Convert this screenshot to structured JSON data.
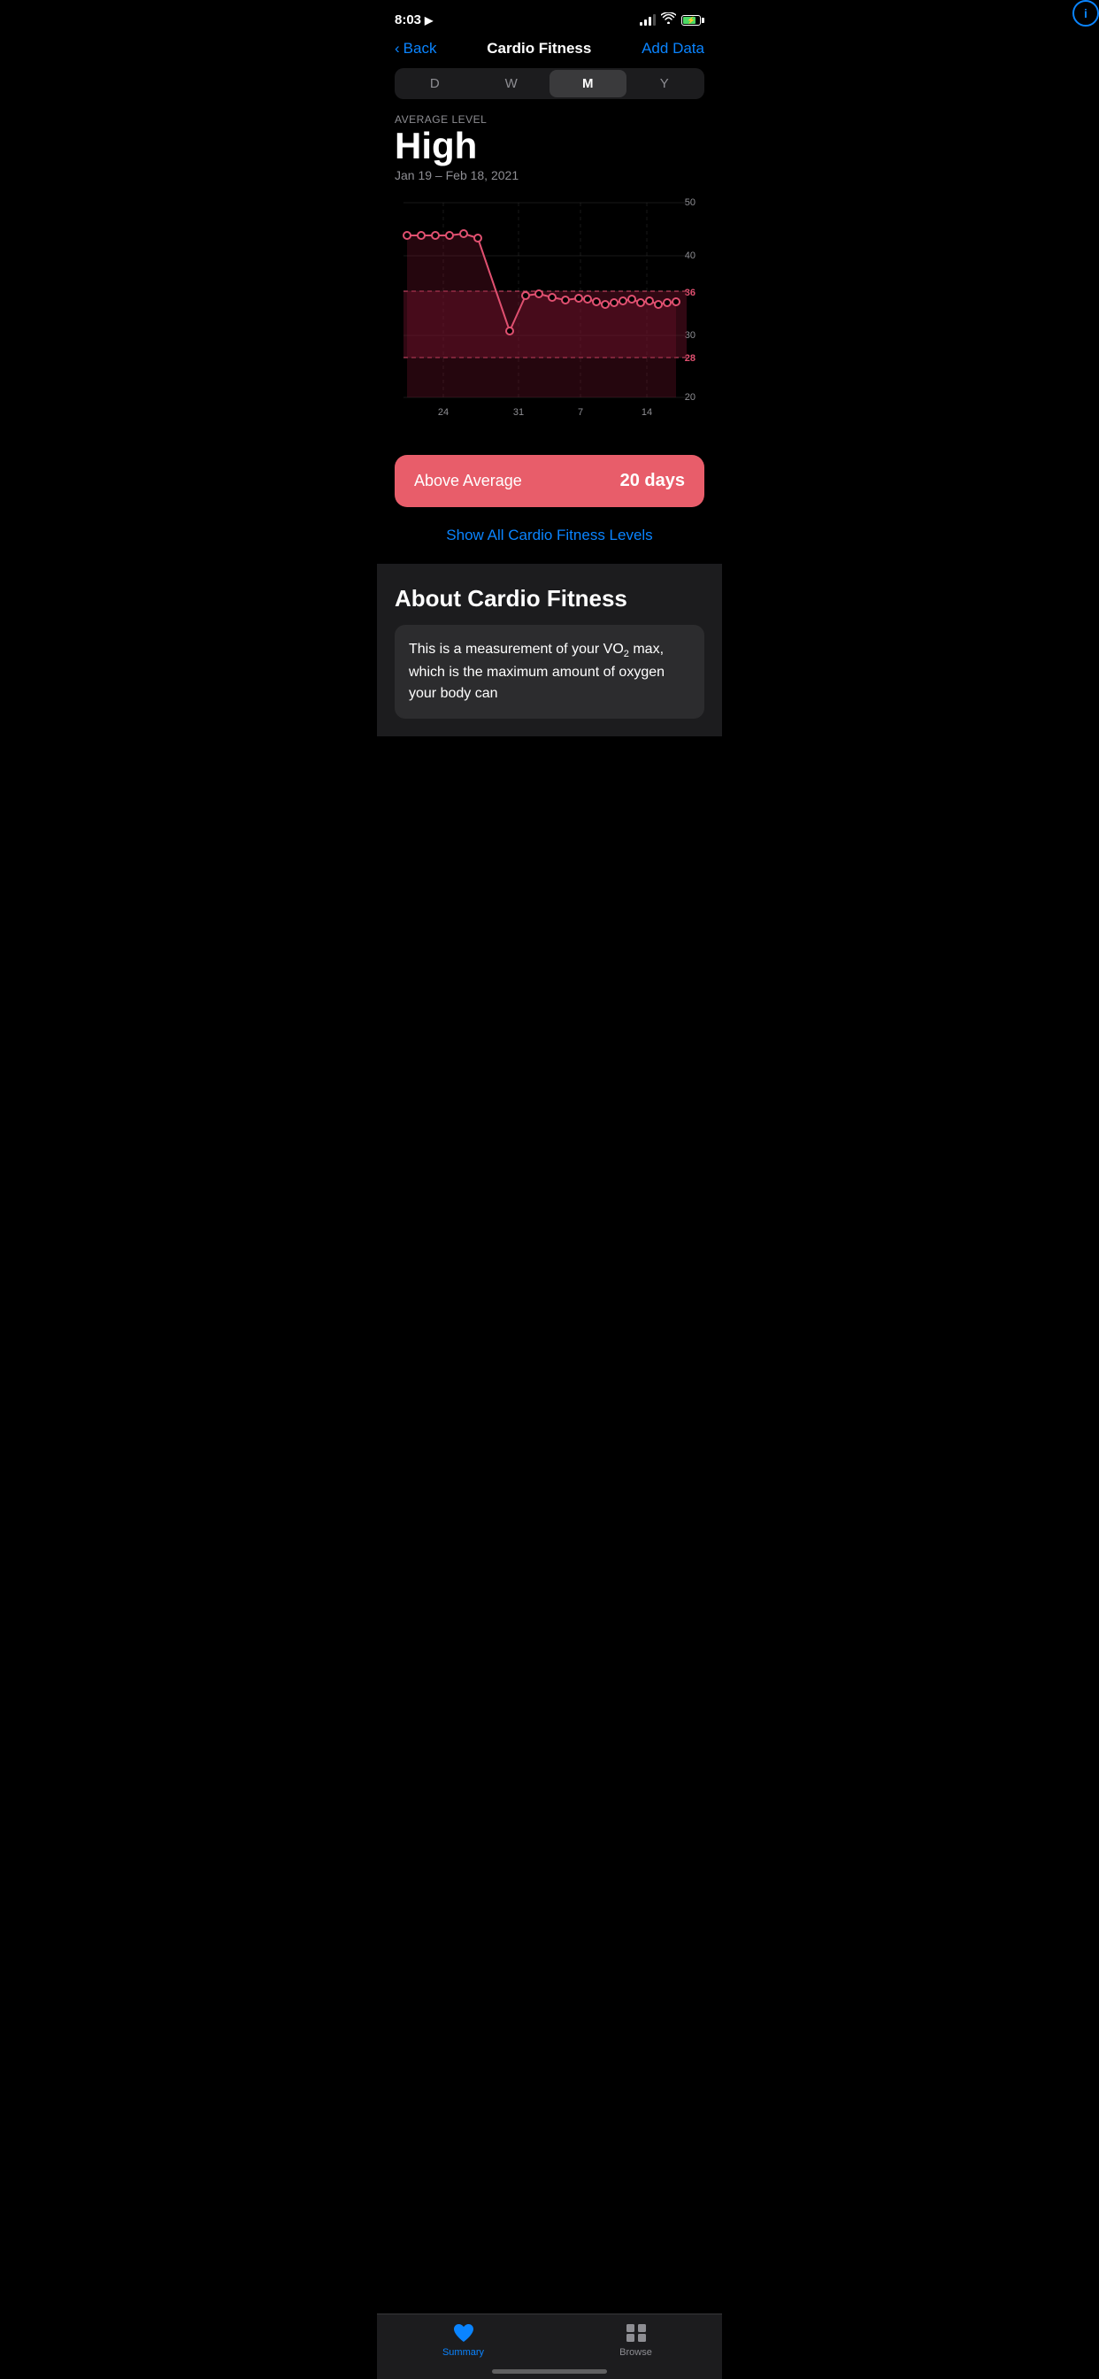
{
  "statusBar": {
    "time": "8:03",
    "locationIcon": "▶"
  },
  "nav": {
    "backLabel": "Back",
    "title": "Cardio Fitness",
    "actionLabel": "Add Data"
  },
  "segmentControl": {
    "items": [
      {
        "label": "D",
        "active": false
      },
      {
        "label": "W",
        "active": false
      },
      {
        "label": "M",
        "active": true
      },
      {
        "label": "Y",
        "active": false
      }
    ]
  },
  "chart": {
    "averageLevelLabel": "AVERAGE LEVEL",
    "averageValue": "High",
    "dateRange": "Jan 19 – Feb 18, 2021",
    "yAxisLabels": [
      "50",
      "40",
      "36",
      "30",
      "28",
      "20"
    ],
    "xAxisLabels": [
      "24",
      "31",
      "7",
      "14"
    ],
    "infoButtonLabel": "i"
  },
  "aboveAvg": {
    "label": "Above Average",
    "value": "20 days"
  },
  "showAllLink": "Show All Cardio Fitness Levels",
  "about": {
    "title": "About Cardio Fitness",
    "bodyText": "This is a measurement of your VO₂ max, which is the maximum amount of oxygen your body can"
  },
  "tabBar": {
    "items": [
      {
        "label": "Summary",
        "active": true
      },
      {
        "label": "Browse",
        "active": false
      }
    ]
  }
}
